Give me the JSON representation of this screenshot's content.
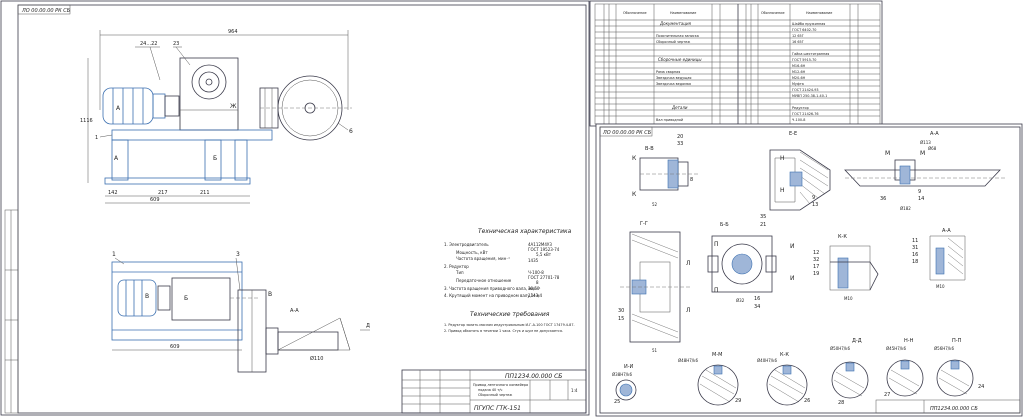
{
  "left_sheet": {
    "stamp": "ЛО 00.00.00 РК СБ",
    "tech_specs_title": "Техническая характеристика",
    "tech_specs": [
      "1. Электродвигатель",
      "Мощность, кВт",
      "Частота вращения, мин⁻¹",
      "2. Редуктор",
      "Тип",
      "Передаточное отношение",
      "3. Частота вращения приводного вала, мин⁻¹",
      "4. Крутящий момент на приводном валу, Н·м"
    ],
    "tech_specs_values": [
      "4А112М4У3",
      "ГОСТ 19523-74",
      "5,5 кВт",
      "1435",
      "Ч-100-8",
      "ГОСТ 27701-78",
      "8",
      "30,50",
      "1143,4"
    ],
    "tech_req_title": "Технические требования",
    "tech_req": [
      "1. Редуктор залить маслом индустриальным И-Г-А-100 ГОСТ 17479.4-87.",
      "2. Привод обкатать в течении 1 часа. Стук и шум не допускается."
    ],
    "title_block": {
      "doc_number": "ПП1234.00.000 СБ",
      "name_line1": "Привод ленточного конвейера",
      "name_line2": "подача 40 т/ч",
      "name_line3": "Сборочный чертеж",
      "org": "ПГУПС ГТК-151",
      "scale": "1:4"
    },
    "dims": [
      "964",
      "1116",
      "24...22",
      "23",
      "609",
      "142",
      "217",
      "211",
      "1",
      "6",
      "3",
      "А",
      "Б",
      "В",
      "Ж",
      "Д",
      "А-А",
      "Ø110"
    ]
  },
  "right_top_sheet": {
    "stamp": "ПП 00.00.00 РК СБ",
    "col_headers": [
      "Формат",
      "Зона",
      "Поз.",
      "Обозначение",
      "Наименование",
      "Кол.",
      "Примечание"
    ],
    "left_sections": [
      "Документация",
      "Сборочные единицы",
      "Детали"
    ],
    "left_rows": [
      "Пояснительная записка",
      "Сборочный чертеж",
      "Рама сварная",
      "Звездочка ведущая",
      "Звездочка ведомая",
      "Вал приводной"
    ],
    "right_sections": [
      "Стандартные изделия",
      "Прочие изделия"
    ],
    "right_rows": [
      "Шайба пружинная",
      "ГОСТ 6402-70",
      "12 65Г",
      "16 65Г",
      "Гайка шестигранная",
      "ГОСТ 5915-70",
      "М16-6Н",
      "М12-6Н",
      "М20-6Н",
      "Муфта",
      "ГОСТ 21424-93",
      "МУВП 250-38-1-40-1",
      "Редуктор",
      "ГОСТ 21426-76",
      "Ч-100-8"
    ]
  },
  "right_main_sheet": {
    "stamp": "ЛО 00.00.00 РК СБ",
    "doc_number": "ПП1234.00.000 СБ",
    "section_labels": [
      "В-В",
      "Е-Е",
      "А-А",
      "Г-Г",
      "Б-Б",
      "К-К",
      "Л-Л",
      "М-М",
      "К-К",
      "Д-Д",
      "Н-Н",
      "П-П",
      "И-И"
    ],
    "positions": [
      "20",
      "33",
      "8",
      "13",
      "9",
      "14",
      "36",
      "35",
      "21",
      "12",
      "32",
      "17",
      "19",
      "16",
      "34",
      "30",
      "15",
      "11",
      "31",
      "18",
      "25",
      "29",
      "26",
      "28",
      "27",
      "24"
    ],
    "letters": [
      "К",
      "Н",
      "М",
      "И",
      "Л",
      "П",
      "Ж",
      "Ж"
    ],
    "dims": [
      "Ø113",
      "Ø68",
      "Ø182",
      "Ø140",
      "Ø58",
      "Ø27",
      "52",
      "Ø30",
      "Ø24",
      "Ø32",
      "М10",
      "51",
      "Ø38Н7/k6",
      "Ø48Н7/k6",
      "Ø40Н7/k6",
      "Ø50Н7/k6",
      "Ø45Н7/k6",
      "Ø56Н7/k6"
    ]
  },
  "chart_data": null
}
